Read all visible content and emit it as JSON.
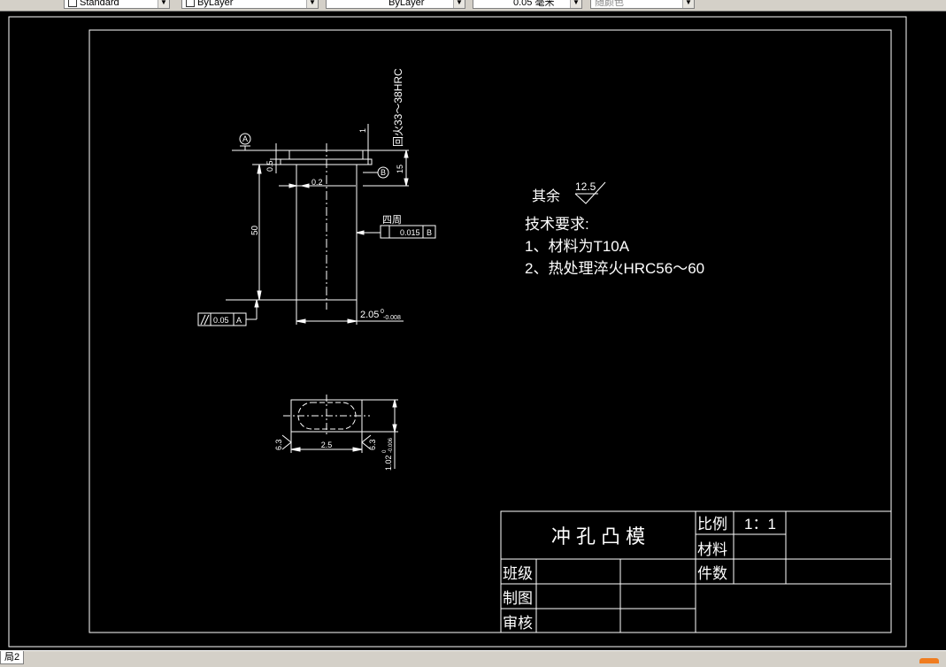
{
  "toolbar": {
    "textstyle_value": "Standard",
    "layer_value": "ByLayer",
    "linetype_value": "ByLayer",
    "lineweight_value": "0.05 毫米",
    "color_value": "随颜色"
  },
  "layout_tab": "局2",
  "drawing": {
    "surface_note_prefix": "其余",
    "surface_note_value": "12.5",
    "tech_title": "技术要求:",
    "tech_item_1": "1、材料为T10A",
    "tech_item_2": "2、热处理淬火HRC56～60",
    "hardness_note": "回火33～38HRC",
    "datum_a": "A",
    "datum_b": "B",
    "dim_05": "0.5",
    "dim_02": "0.2",
    "dim_50": "50",
    "dim_15": "15",
    "dim_1": "1",
    "dim_diameter": "2.05",
    "dim_diameter_tol_upper": "0",
    "dim_diameter_tol_lower": "-0.008",
    "perimeter_label": "四周",
    "runout_tol": "0.015",
    "parallel_tol": "0.05",
    "dim_25": "2.5",
    "dim_102": "1.02",
    "dim_102_tol_upper": "0",
    "dim_102_tol_lower": "-0.006",
    "rough_63_left": "6.3",
    "rough_63_right": "6.3"
  },
  "title_block": {
    "part_name": "冲 孔 凸 模",
    "scale_label": "比例",
    "scale_value": "1：1",
    "material_label": "材料",
    "class_label": "班级",
    "quantity_label": "件数",
    "drawn_label": "制图",
    "checked_label": "审核"
  }
}
